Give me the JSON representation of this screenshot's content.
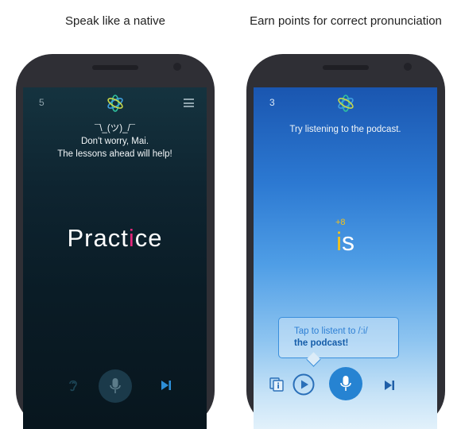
{
  "left_panel": {
    "caption": "Speak like a native",
    "lesson_number": "5",
    "message_line1": "¯\\_(ツ)_/¯",
    "message_line2": "Don't worry, Mai.",
    "message_line3": "The lessons ahead will help!",
    "word_before": "Pract",
    "word_highlight": "i",
    "word_after": "ce",
    "highlight_color": "#e4267a",
    "icons": [
      "logo-icon",
      "menu-icon",
      "ear-icon",
      "microphone-icon",
      "skip-forward-icon"
    ]
  },
  "right_panel": {
    "caption": "Earn points for correct pronunciation",
    "lesson_number": "3",
    "message": "Try listening to the podcast.",
    "points": "+8",
    "word_highlight": "i",
    "word_after": "s",
    "highlight_color": "#f4c21a",
    "tooltip_line1": "Tap to listent to /:i/",
    "tooltip_line2": "the podcast!",
    "icons": [
      "logo-icon",
      "card-info-icon",
      "play-icon",
      "microphone-icon",
      "skip-forward-icon"
    ]
  }
}
